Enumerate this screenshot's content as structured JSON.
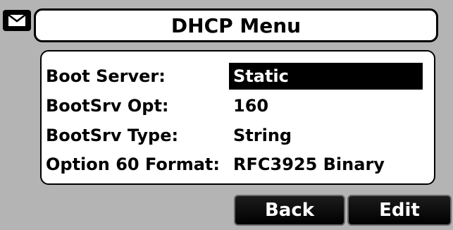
{
  "header": {
    "icon": "envelope-icon",
    "title": "DHCP Menu"
  },
  "menu": {
    "rows": [
      {
        "label": "Boot Server:",
        "value": "Static",
        "selected": true
      },
      {
        "label": "BootSrv Opt:",
        "value": "160",
        "selected": false
      },
      {
        "label": "BootSrv Type:",
        "value": "String",
        "selected": false
      },
      {
        "label": "Option 60 Format:",
        "value": "RFC3925 Binary",
        "selected": false
      }
    ]
  },
  "softkeys": {
    "back_label": "Back",
    "edit_label": "Edit"
  },
  "colors": {
    "background": "#b4b4b4",
    "panel": "#ffffff",
    "selection": "#000000",
    "softkey": "#000000"
  }
}
